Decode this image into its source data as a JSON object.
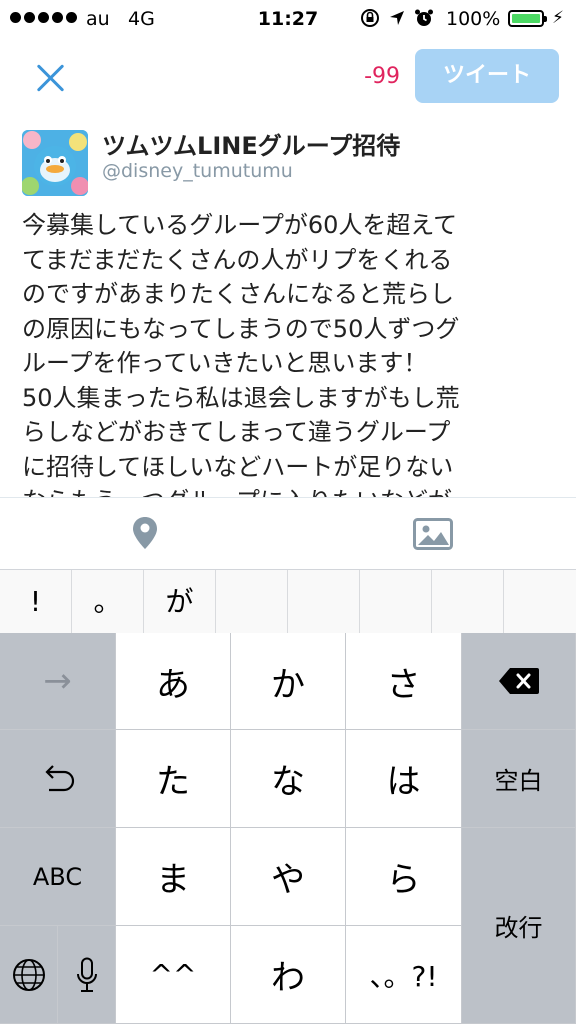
{
  "status_bar": {
    "carrier": "au",
    "network": "4G",
    "time": "11:27",
    "battery_percent": "100%",
    "icons": [
      "orientation-lock-icon",
      "location-arrow-icon",
      "alarm-icon",
      "battery-icon",
      "charging-bolt-icon"
    ]
  },
  "compose": {
    "char_counter": "-99",
    "tweet_button": "ツイート"
  },
  "author": {
    "name": "ツムツムLINEグループ招待",
    "handle": "@disney_tumutumu"
  },
  "tweet_lines": [
    "今募集しているグループが60人を超えて",
    "てまだまだたくさんの人がリプをくれる",
    "のですがあまりたくさんになると荒らし",
    "の原因にもなってしまうので50人ずつグ",
    "ループを作っていきたいと思います！",
    "50人集まったら私は退会しますがもし荒",
    "らしなどがおきてしまって違うグループ",
    "に招待してほしいなどハートが足りない",
    "ならもう一つグループに入りたいなどが"
  ],
  "toolbar": {
    "icons": [
      "location-pin-icon",
      "image-icon"
    ]
  },
  "candidates": [
    "!",
    "。",
    "が",
    "",
    "",
    "",
    "",
    ""
  ],
  "keyboard": {
    "row1": {
      "arrow": "→",
      "k1": "あ",
      "k2": "か",
      "k3": "さ"
    },
    "row2": {
      "undo": "undo-icon",
      "k1": "た",
      "k2": "な",
      "k3": "は",
      "space": "空白"
    },
    "row3": {
      "abc": "ABC",
      "k1": "ま",
      "k2": "や",
      "k3": "ら",
      "enter": "改行"
    },
    "row4": {
      "k1": "^^",
      "k2": "わ",
      "k3": "、。?!"
    },
    "icons": [
      "globe-icon",
      "microphone-icon",
      "backspace-icon"
    ]
  },
  "colors": {
    "accent_blue": "#3b94d9",
    "tweet_button_disabled": "#a8d3f5",
    "counter_red": "#e0245e",
    "battery_green": "#4cd964",
    "keyboard_bg": "#d1d5db"
  }
}
